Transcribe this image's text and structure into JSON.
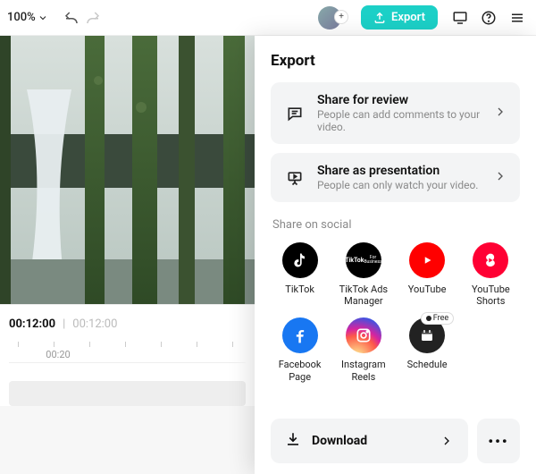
{
  "topbar": {
    "zoom_label": "100%",
    "export_label": "Export"
  },
  "timeline": {
    "current": "00:12:00",
    "total": "00:12:00",
    "ruler_tick": "00:20"
  },
  "panel": {
    "title": "Export",
    "review": {
      "title": "Share for review",
      "sub": "People can add comments to your video."
    },
    "presentation": {
      "title": "Share as presentation",
      "sub": "People can only watch your video."
    },
    "share_section_label": "Share on social",
    "social": {
      "tiktok": "TikTok",
      "tiktok_ads": "TikTok Ads Manager",
      "youtube": "YouTube",
      "shorts": "YouTube Shorts",
      "facebook": "Facebook Page",
      "instagram": "Instagram Reels",
      "schedule": "Schedule",
      "schedule_badge": "Free"
    },
    "download_label": "Download"
  }
}
